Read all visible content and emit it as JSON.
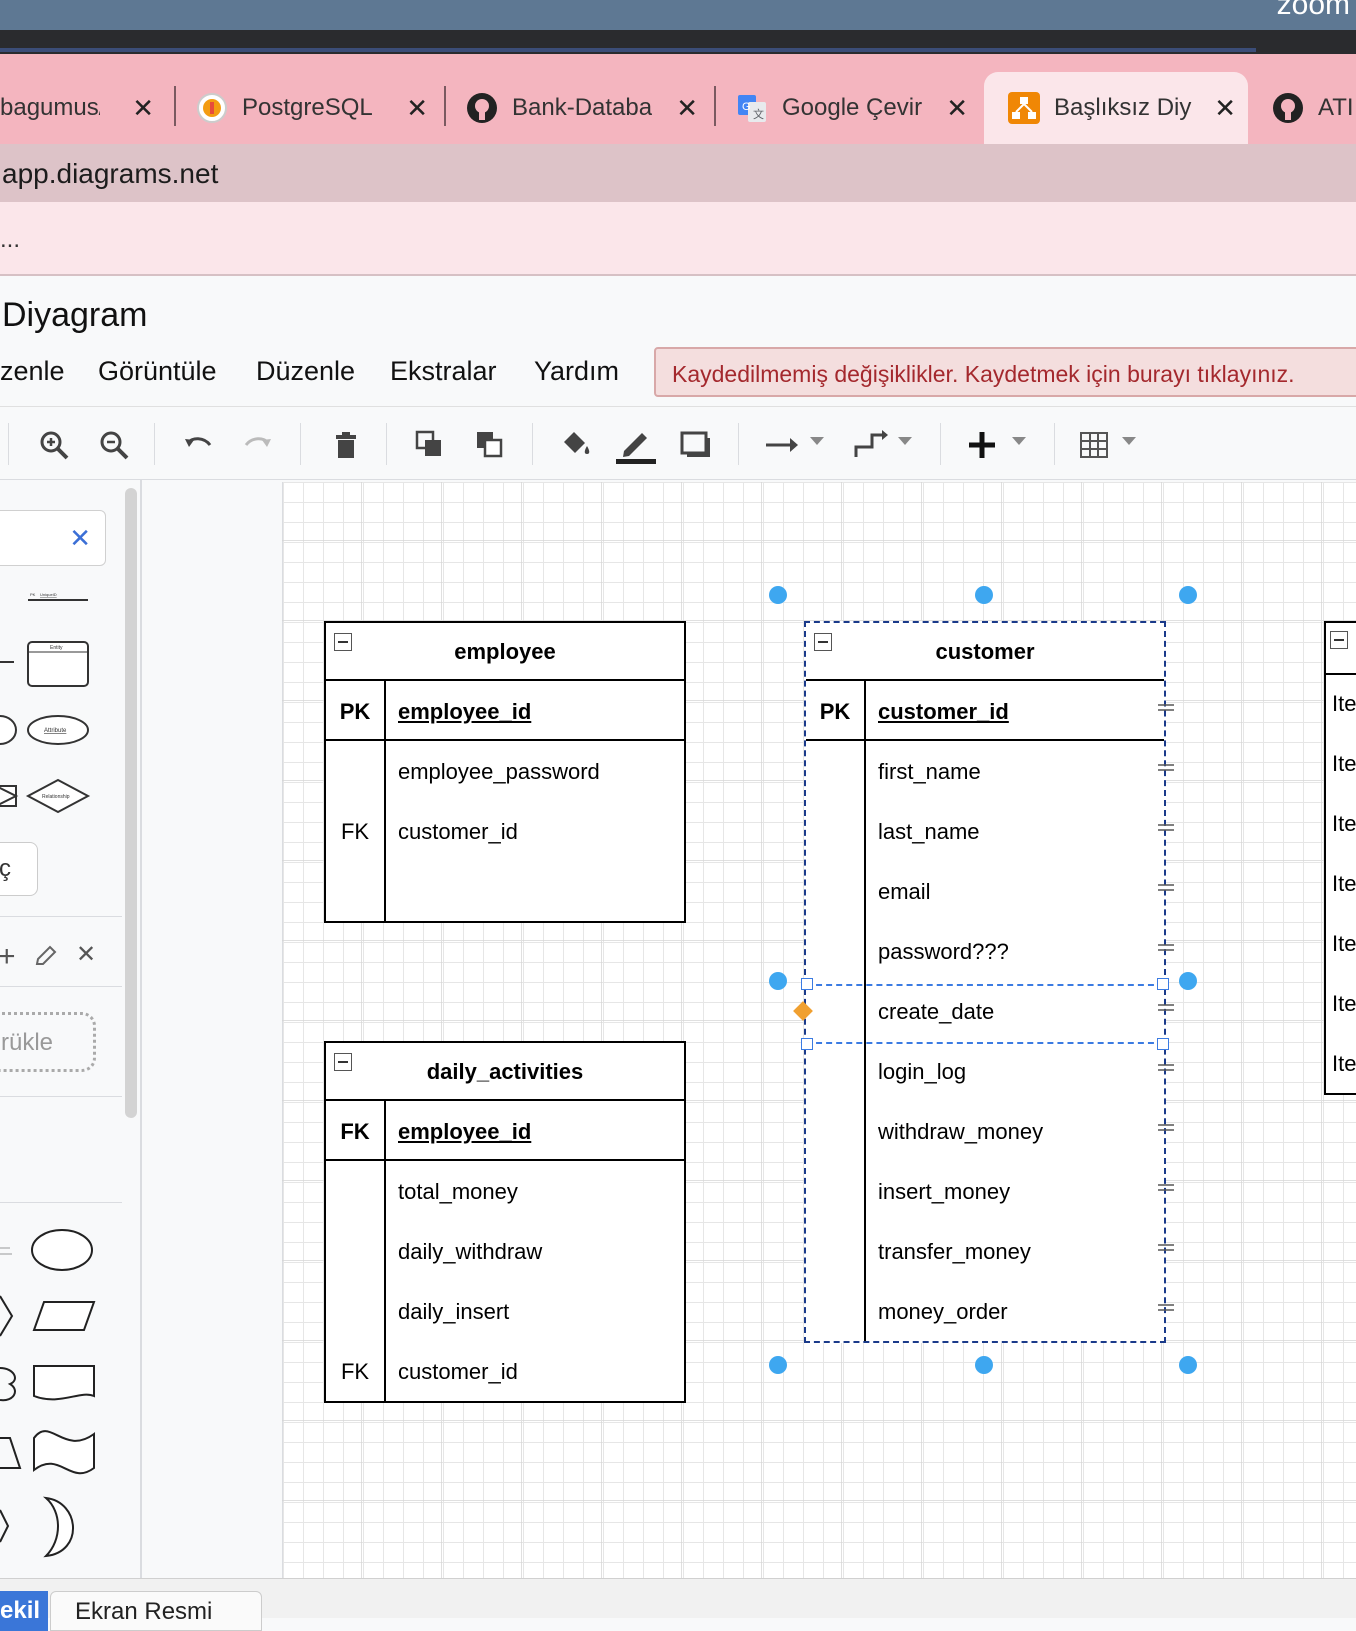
{
  "desktop": {
    "corner_text": "zoom"
  },
  "browser": {
    "tabs": [
      {
        "label": "bagumus/A",
        "icon": "document-icon"
      },
      {
        "label": "PostgreSQL",
        "icon": "postgresql-icon"
      },
      {
        "label": "Bank-Databa",
        "icon": "github-icon"
      },
      {
        "label": "Google Çevir",
        "icon": "google-translate-icon"
      },
      {
        "label": "Başlıksız Diy",
        "icon": "drawio-icon",
        "active": true
      },
      {
        "label": "ATI",
        "icon": "github-icon"
      }
    ],
    "address": "app.diagrams.net",
    "bookmarks_text": "..."
  },
  "app": {
    "title": "Diyagram",
    "menu": [
      "zenle",
      "Görüntüle",
      "Düzenle",
      "Ekstralar",
      "Yardım"
    ],
    "unsaved_notice": "Kaydedilmemiş değişiklikler. Kaydetmek için burayı tıklayınız."
  },
  "toolbar": {
    "buttons": [
      "zoom-in-icon",
      "zoom-out-icon",
      "undo-icon",
      "redo-icon",
      "delete-icon",
      "to-front-icon",
      "to-back-icon",
      "fill-color-icon",
      "line-color-icon",
      "shadow-icon",
      "connection-icon",
      "waypoints-icon",
      "insert-icon",
      "table-icon"
    ]
  },
  "sidebar": {
    "drag_hint": "rükle",
    "misc_label": "ç",
    "shape_labels": {
      "entity": "Entity",
      "attribute": "Attribute",
      "relationship": "Relationship",
      "pk": "PK",
      "unique_id": "UniqueID"
    }
  },
  "diagram": {
    "employee": {
      "title": "employee",
      "pk": {
        "key": "PK",
        "name": "employee_id"
      },
      "rows": [
        {
          "key": "",
          "name": "employee_password"
        },
        {
          "key": "FK",
          "name": "customer_id"
        },
        {
          "key": "",
          "name": ""
        }
      ]
    },
    "daily_activities": {
      "title": "daily_activities",
      "pk": {
        "key": "FK",
        "name": "employee_id"
      },
      "rows": [
        {
          "key": "",
          "name": "total_money"
        },
        {
          "key": "",
          "name": "daily_withdraw"
        },
        {
          "key": "",
          "name": "daily_insert"
        },
        {
          "key": "FK",
          "name": "customer_id"
        }
      ]
    },
    "customer": {
      "title": "customer",
      "pk": {
        "key": "PK",
        "name": "customer_id"
      },
      "rows": [
        {
          "key": "",
          "name": "first_name"
        },
        {
          "key": "",
          "name": "last_name"
        },
        {
          "key": "",
          "name": "email"
        },
        {
          "key": "",
          "name": "password???"
        },
        {
          "key": "",
          "name": "create_date"
        },
        {
          "key": "",
          "name": "login_log"
        },
        {
          "key": "",
          "name": "withdraw_money"
        },
        {
          "key": "",
          "name": "insert_money"
        },
        {
          "key": "",
          "name": "transfer_money"
        },
        {
          "key": "",
          "name": "money_order"
        }
      ]
    },
    "partial_table": {
      "rows": [
        "Ite",
        "Ite",
        "Ite",
        "Ite",
        "Ite",
        "Ite",
        "Ite"
      ]
    }
  },
  "bottom": {
    "page_tab": "Ekran Resmi",
    "left_tab": "ekil"
  },
  "colors": {
    "tab_bar": "#f4b5bf",
    "active_tab": "#fbe6ea",
    "unsaved_text": "#a4282d",
    "selection": "#3ea7f0",
    "page_blue": "#3a76d8"
  }
}
